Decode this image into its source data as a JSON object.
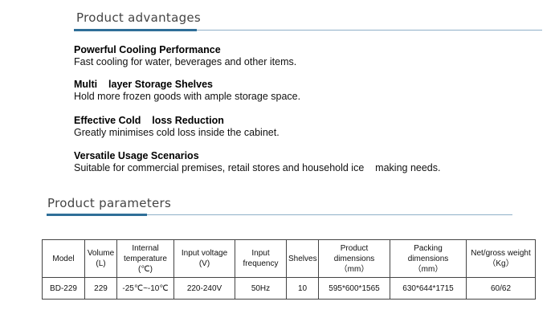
{
  "advantages": {
    "heading": "Product advantages",
    "items": [
      {
        "title": "Powerful Cooling Performance",
        "desc": "Fast cooling for water, beverages and other items."
      },
      {
        "title": "Multi    layer Storage Shelves",
        "desc": "Hold more frozen goods with ample storage space."
      },
      {
        "title": "Effective Cold    loss Reduction",
        "desc": "Greatly minimises cold loss inside the cabinet."
      },
      {
        "title": "Versatile Usage Scenarios",
        "desc": "Suitable for commercial premises, retail stores and household ice    making needs."
      }
    ]
  },
  "parameters": {
    "heading": "Product parameters",
    "headers": [
      [
        "Model"
      ],
      [
        "Volume",
        "(L)"
      ],
      [
        "Internal",
        "temperature",
        "(℃)"
      ],
      [
        "Input voltage",
        "(V)"
      ],
      [
        "Input",
        "frequency"
      ],
      [
        "Shelves"
      ],
      [
        "Product",
        "dimensions",
        "（mm）"
      ],
      [
        "Packing",
        "dimensions",
        "（mm）"
      ],
      [
        "Net/gross weight",
        "（Kg）"
      ]
    ],
    "rows": [
      [
        "BD-229",
        "229",
        "-25℃~-10℃",
        "220-240V",
        "50Hz",
        "10",
        "595*600*1565",
        "630*644*1715",
        "60/62"
      ]
    ]
  },
  "colors": {
    "rule": "#8fb0c8",
    "accent": "#2f6f98"
  }
}
